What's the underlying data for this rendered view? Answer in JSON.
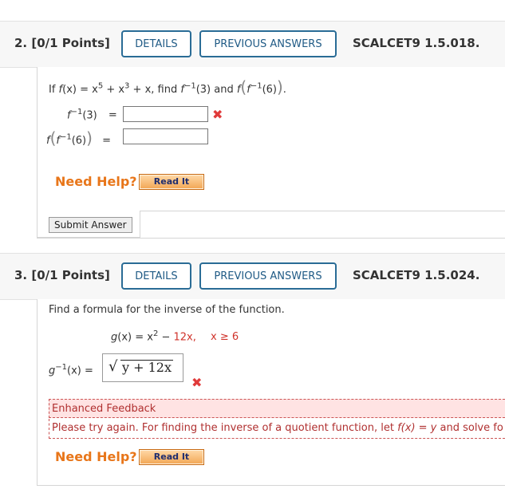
{
  "q2": {
    "number": "2.",
    "points": "[0/1 Points]",
    "details_label": "DETAILS",
    "prev_answers_label": "PREVIOUS ANSWERS",
    "code": "SCALCET9 1.5.018.",
    "prompt_if": "If ",
    "prompt_f": "f",
    "prompt_x_eq": "(x) = x",
    "exp5": "5",
    "plus_x": " + x",
    "exp3": "3",
    "plus_x_find": " + x, find ",
    "f_inv": "f",
    "inv_exp": "−1",
    "of_3": "(3)",
    "and": " and ",
    "f_outer": "f",
    "of_6": "(6)",
    "period": ".",
    "label1_f": "f",
    "label1_exp": "−1",
    "label1_arg": "(3)",
    "eq": "=",
    "label2_f": "f",
    "label2_inner_f": "f",
    "label2_exp": "−1",
    "label2_arg": "(6)",
    "answer1_value": "",
    "answer2_value": "",
    "need_help": "Need Help?",
    "read_it": "Read It",
    "submit": "Submit Answer"
  },
  "q3": {
    "number": "3.",
    "points": "[0/1 Points]",
    "details_label": "DETAILS",
    "prev_answers_label": "PREVIOUS ANSWERS",
    "code": "SCALCET9 1.5.024.",
    "prompt": "Find a formula for the inverse of the function.",
    "g": "g",
    "gx_eq": "(x) = x",
    "exp2": "2",
    "minus": " − ",
    "twelve_x": "12x,",
    "cond": "x ≥ 6",
    "ginv_g": "g",
    "ginv_exp": "−1",
    "ginv_x_eq": "(x) =",
    "answer_sqrt": "√",
    "answer_value": "y + 12x",
    "feedback_title": "Enhanced Feedback",
    "feedback_text": "Please try again. For finding the inverse of a quotient function, let ",
    "feedback_fx": "f(x) = y",
    "feedback_tail": " and solve fo",
    "need_help": "Need Help?",
    "read_it": "Read It"
  },
  "colors": {
    "accent_blue": "#2a6c96",
    "incorrect_red": "#e03a3a",
    "help_orange": "#e8761a",
    "feedback_bg": "#ffe3e3"
  },
  "icons": {
    "incorrect": "x-mark-icon"
  }
}
